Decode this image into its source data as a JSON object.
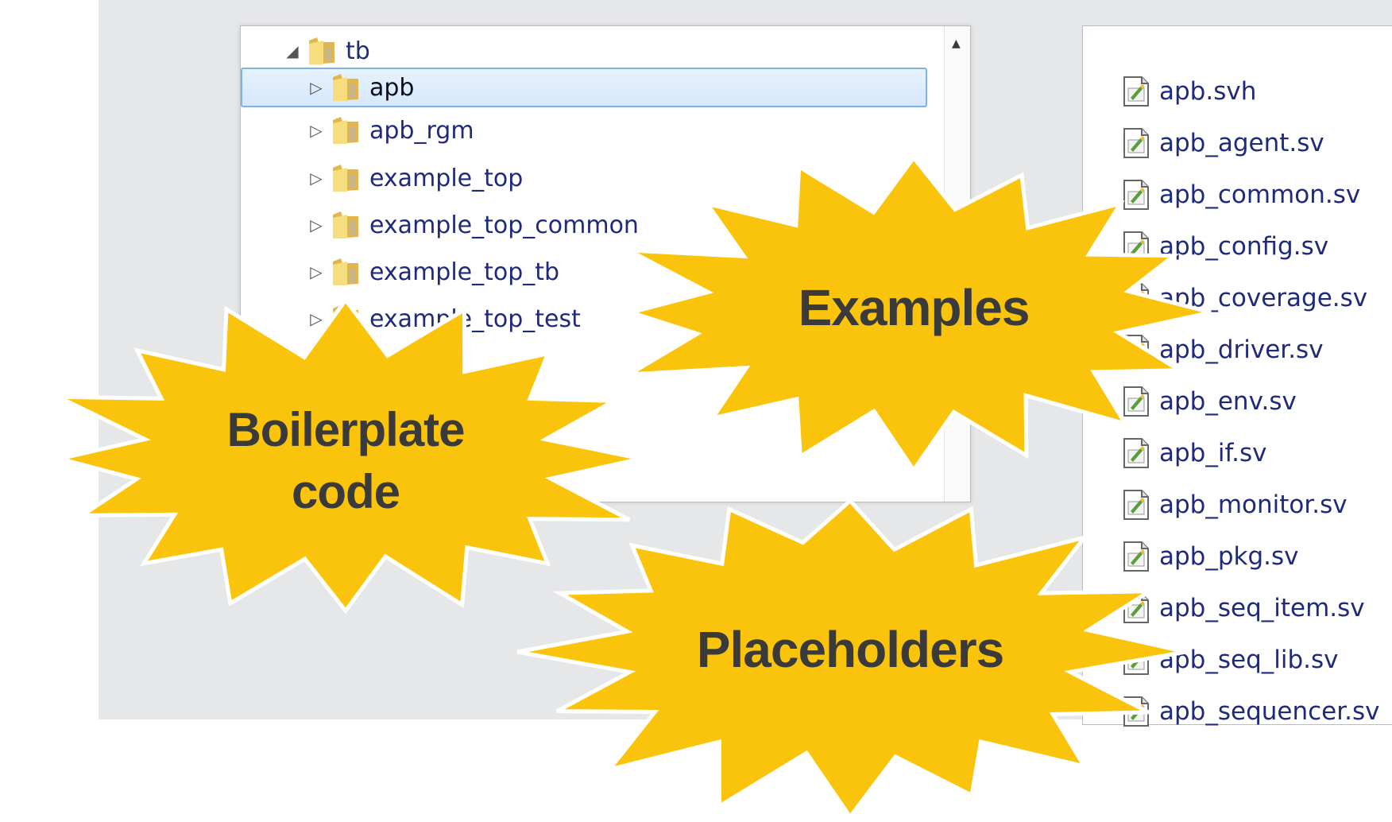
{
  "tree": {
    "root": "tb",
    "items": [
      {
        "label": "apb",
        "selected": true
      },
      {
        "label": "apb_rgm",
        "selected": false
      },
      {
        "label": "example_top",
        "selected": false
      },
      {
        "label": "example_top_common",
        "selected": false
      },
      {
        "label": "example_top_tb",
        "selected": false
      },
      {
        "label": "example_top_test",
        "selected": false
      }
    ],
    "scroll_up_icon": "▲"
  },
  "files": [
    "apb.svh",
    "apb_agent.sv",
    "apb_common.sv",
    "apb_config.sv",
    "apb_coverage.sv",
    "apb_driver.sv",
    "apb_env.sv",
    "apb_if.sv",
    "apb_monitor.sv",
    "apb_pkg.sv",
    "apb_seq_item.sv",
    "apb_seq_lib.sv",
    "apb_sequencer.sv"
  ],
  "callouts": {
    "examples": "Examples",
    "boilerplate_line1": "Boilerplate",
    "boilerplate_line2": "code",
    "placeholders": "Placeholders"
  },
  "colors": {
    "burst_fill": "#fbc40c",
    "burst_text": "#3a3a3a",
    "text_link": "#1f2a7a",
    "background": "#e6e7e9"
  }
}
